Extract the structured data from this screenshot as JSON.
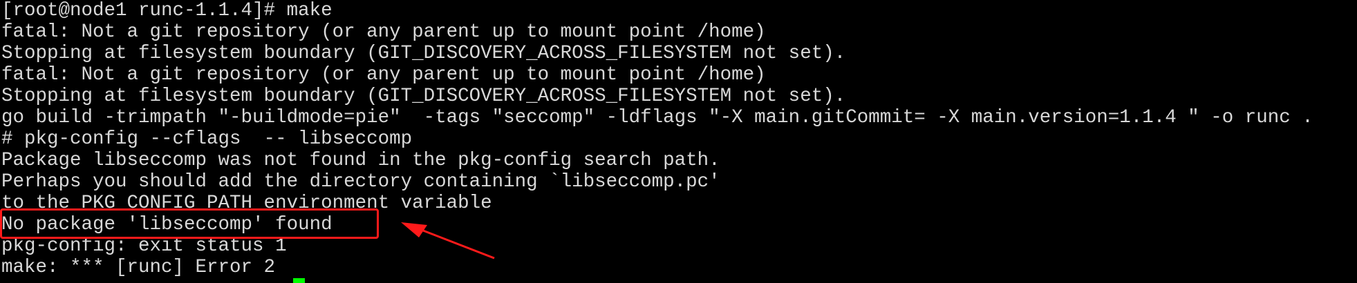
{
  "terminal": {
    "lines": [
      "[root@node1 runc-1.1.4]# make",
      "fatal: Not a git repository (or any parent up to mount point /home)",
      "Stopping at filesystem boundary (GIT_DISCOVERY_ACROSS_FILESYSTEM not set).",
      "fatal: Not a git repository (or any parent up to mount point /home)",
      "Stopping at filesystem boundary (GIT_DISCOVERY_ACROSS_FILESYSTEM not set).",
      "go build -trimpath \"-buildmode=pie\"  -tags \"seccomp\" -ldflags \"-X main.gitCommit= -X main.version=1.1.4 \" -o runc .",
      "# pkg-config --cflags  -- libseccomp",
      "Package libseccomp was not found in the pkg-config search path.",
      "Perhaps you should add the directory containing `libseccomp.pc'",
      "to the PKG_CONFIG_PATH environment variable",
      "No package 'libseccomp' found",
      "pkg-config: exit status 1",
      "make: *** [runc] Error 2"
    ]
  },
  "colors": {
    "background": "#000000",
    "text": "#d8d8d8",
    "cursor": "#00ff00",
    "annotation": "#ff1a1a"
  }
}
